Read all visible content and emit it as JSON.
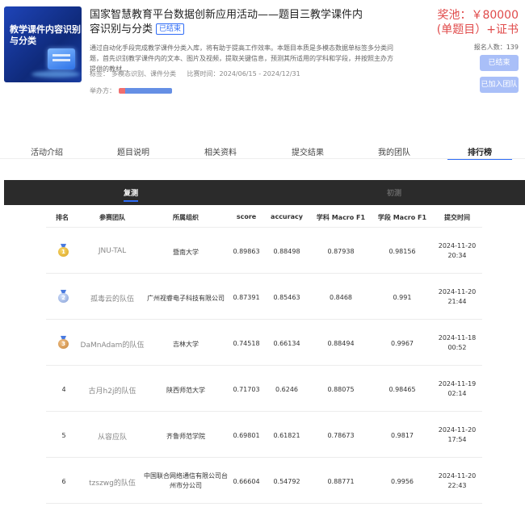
{
  "header": {
    "cover_title": "教学课件内容识别与分类",
    "title": "国家智慧教育平台数据创新应用活动——题目三教学课件内容识别与分类",
    "status_tag": "已结束",
    "description": "通过自动化手段完成教学课件分类入库，将有助于提高工作效率。本题目本质是多模态数据单标签多分类问题，首先识别教学课件内的文本、图片及视频，提取关键信息，预测其所适用的学科和学段，并按照主办方提供的教材...",
    "tags_label": "标签：",
    "tags": [
      "多模态识别、",
      "课件分类"
    ],
    "time_label": "比赛时间：",
    "time_range": "2024/06/15 - 2024/12/31",
    "organizer_label": "举办方：",
    "prize_line1": "奖池：￥80000",
    "prize_line2": "(单题目）+证书",
    "signup_count": "报名人数：139",
    "btn_ended": "已结束",
    "btn_joined": "已加入团队"
  },
  "tabs": [
    "活动介绍",
    "题目说明",
    "相关资料",
    "提交结果",
    "我的团队",
    "排行榜"
  ],
  "stages": [
    "复测",
    "初测"
  ],
  "leaderboard": {
    "columns": [
      "排名",
      "参赛团队",
      "所属组织",
      "score",
      "accuracy",
      "学科 Macro F1",
      "学段 Macro F1",
      "提交时间"
    ],
    "rows": [
      {
        "rank": "1",
        "team": "JNU-TAL",
        "org": "暨南大学",
        "score": "0.89863",
        "accuracy": "0.88498",
        "subject_f1": "0.87938",
        "stage_f1": "0.98156",
        "date": "2024-11-20",
        "time": "20:34"
      },
      {
        "rank": "2",
        "team": "孤毒云的队伍",
        "org": "广州视睿电子科技有限公司",
        "score": "0.87391",
        "accuracy": "0.85463",
        "subject_f1": "0.8468",
        "stage_f1": "0.991",
        "date": "2024-11-20",
        "time": "21:44"
      },
      {
        "rank": "3",
        "team": "DaMnAdam的队伍",
        "org": "吉林大学",
        "score": "0.74518",
        "accuracy": "0.66134",
        "subject_f1": "0.88494",
        "stage_f1": "0.9967",
        "date": "2024-11-18",
        "time": "00:52"
      },
      {
        "rank": "4",
        "team": "古月h2j的队伍",
        "org": "陕西师范大学",
        "score": "0.71703",
        "accuracy": "0.6246",
        "subject_f1": "0.88075",
        "stage_f1": "0.98465",
        "date": "2024-11-19",
        "time": "02:14"
      },
      {
        "rank": "5",
        "team": "从容应队",
        "org": "齐鲁师范学院",
        "score": "0.69801",
        "accuracy": "0.61821",
        "subject_f1": "0.78673",
        "stage_f1": "0.9817",
        "date": "2024-11-20",
        "time": "17:54"
      },
      {
        "rank": "6",
        "team": "tzszwg的队伍",
        "org_line1": "中国联合网络通信有限公司台",
        "org_line2": "州市分公司",
        "score": "0.66604",
        "accuracy": "0.54792",
        "subject_f1": "0.88771",
        "stage_f1": "0.9956",
        "date": "2024-11-20",
        "time": "22:43"
      }
    ]
  },
  "colors": {
    "accent": "#2f6cf6",
    "prize": "#e04a4a",
    "stage_bar": "#2b2b2b",
    "button": "#a9bff8"
  }
}
